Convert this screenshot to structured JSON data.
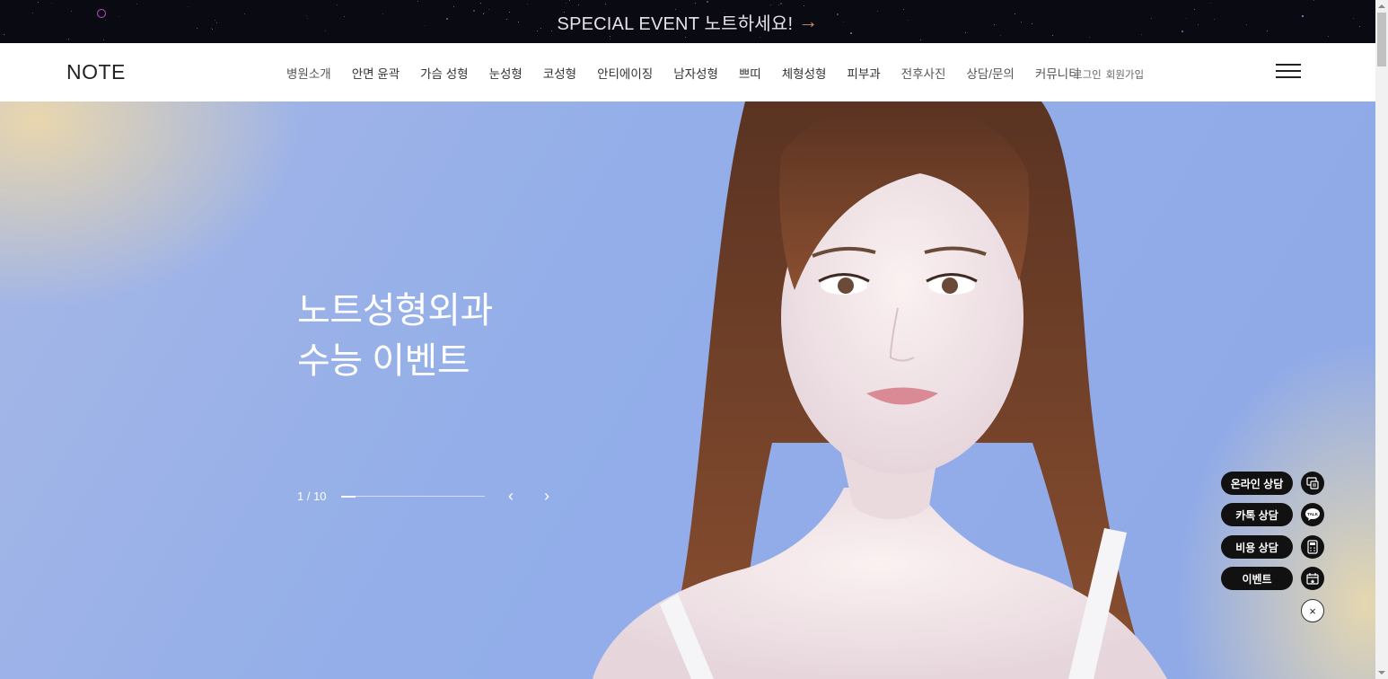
{
  "banner": {
    "text": "SPECIAL EVENT 노트하세요!",
    "arrow": "→"
  },
  "header": {
    "logo": "NOTE",
    "nav": [
      {
        "label": "병원소개"
      },
      {
        "label": "안면 윤곽"
      },
      {
        "label": "가슴 성형"
      },
      {
        "label": "눈성형"
      },
      {
        "label": "코성형"
      },
      {
        "label": "안티에이징"
      },
      {
        "label": "남자성형"
      },
      {
        "label": "쁘띠"
      },
      {
        "label": "체형성형"
      },
      {
        "label": "피부과"
      },
      {
        "label": "전후사진"
      },
      {
        "label": "상담/문의"
      },
      {
        "label": "커뮤니티"
      }
    ],
    "login": "로그인",
    "signup": "회원가입",
    "menu_icon": "hamburger-icon"
  },
  "hero": {
    "title_line1": "노트성형외과",
    "title_line2": "수능 이벤트",
    "pager": "1 / 10",
    "progress": 0.1,
    "prev": "‹",
    "next": "›"
  },
  "floating": {
    "buttons": [
      {
        "label": "온라인 상담",
        "icon": "chat-form-icon"
      },
      {
        "label": "카톡 상담",
        "icon": "kakao-talk-icon"
      },
      {
        "label": "비용 상담",
        "icon": "calculator-icon"
      },
      {
        "label": "이벤트",
        "icon": "gift-calendar-icon"
      }
    ],
    "close": "×"
  },
  "colors": {
    "banner_bg": "#0a0a12",
    "hero_blue": "#93aee9",
    "hero_gold": "#ecd8aa",
    "pill_bg": "#111111"
  }
}
